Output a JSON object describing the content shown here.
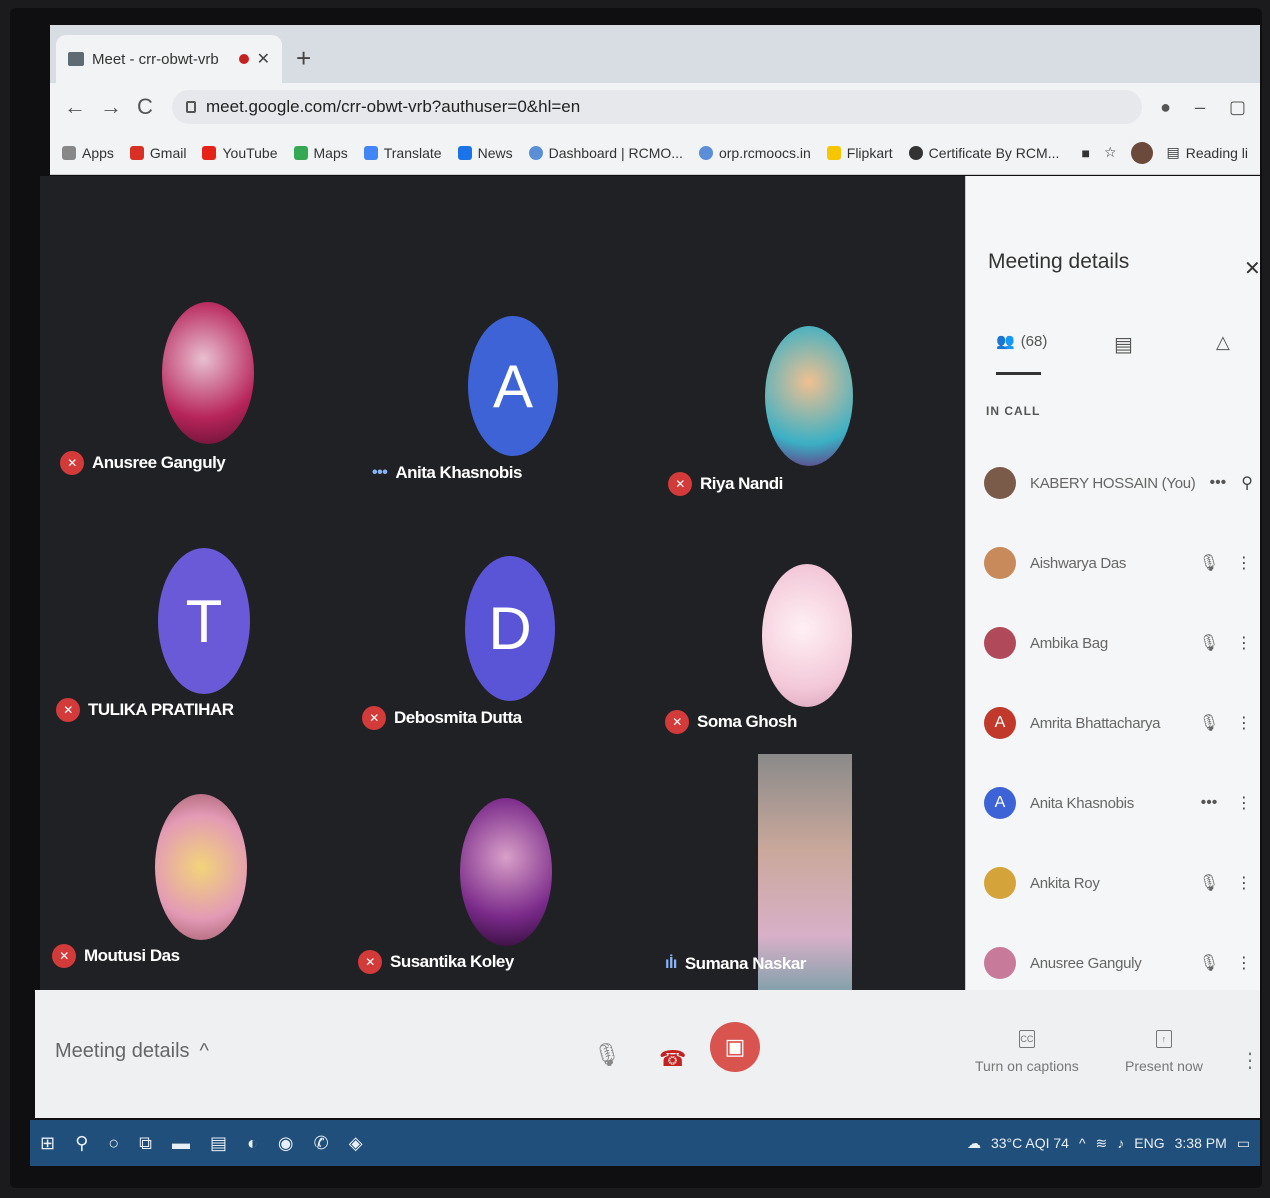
{
  "browser": {
    "tab_title": "Meet - crr-obwt-vrb",
    "url": "meet.google.com/crr-obwt-vrb?authuser=0&hl=en",
    "bookmarks": [
      "Apps",
      "Gmail",
      "YouTube",
      "Maps",
      "Translate",
      "News",
      "Dashboard | RCMO...",
      "orp.rcmoocs.in",
      "Flipkart",
      "Certificate By RCM..."
    ],
    "reading_list": "Reading li"
  },
  "tiles": [
    {
      "name": "Anusree Ganguly",
      "letter": "",
      "status": "muted"
    },
    {
      "name": "Anita Khasnobis",
      "letter": "A",
      "status": "dots"
    },
    {
      "name": "Riya Nandi",
      "letter": "",
      "status": "muted"
    },
    {
      "name": "TULIKA PRATIHAR",
      "letter": "T",
      "status": "muted"
    },
    {
      "name": "Debosmita Dutta",
      "letter": "D",
      "status": "muted"
    },
    {
      "name": "Soma Ghosh",
      "letter": "",
      "status": "muted"
    },
    {
      "name": "Moutusi Das",
      "letter": "",
      "status": "muted"
    },
    {
      "name": "Susantika Koley",
      "letter": "",
      "status": "muted"
    },
    {
      "name": "Sumana Naskar",
      "letter": "",
      "status": "speaking"
    }
  ],
  "panel": {
    "title": "Meeting details",
    "people_count": "(68)",
    "section": "IN CALL",
    "participants": [
      {
        "name": "KABERY HOSSAIN (You)",
        "letter": "",
        "color": "#7a5a48"
      },
      {
        "name": "Aishwarya Das",
        "letter": "",
        "color": "#c88a5a"
      },
      {
        "name": "Ambika Bag",
        "letter": "",
        "color": "#b04a5a"
      },
      {
        "name": "Amrita Bhattacharya",
        "letter": "A",
        "color": "#c0392b"
      },
      {
        "name": "Anita Khasnobis",
        "letter": "A",
        "color": "#3d63d6"
      },
      {
        "name": "Ankita Roy",
        "letter": "",
        "color": "#d4a33a"
      },
      {
        "name": "Anusree Ganguly",
        "letter": "",
        "color": "#c87a9a"
      }
    ]
  },
  "controls": {
    "meeting_details": "Meeting details",
    "captions": "Turn on captions",
    "present": "Present now",
    "cc_label": "CC"
  },
  "taskbar": {
    "weather": "33°C AQI 74",
    "lang": "ENG",
    "time": "3:38 PM"
  }
}
